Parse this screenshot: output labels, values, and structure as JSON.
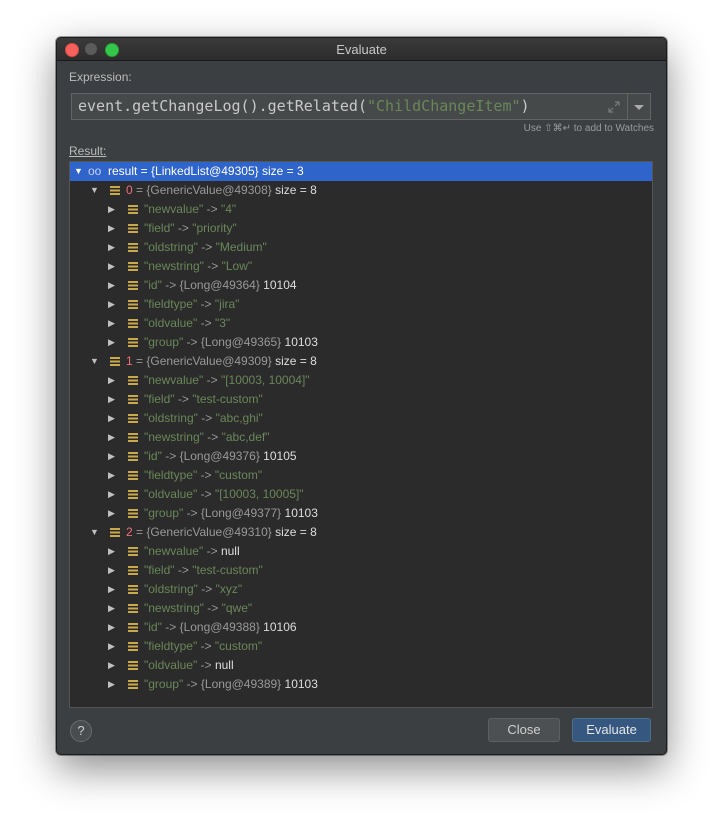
{
  "window": {
    "title": "Evaluate"
  },
  "expression": {
    "label": "Expression:",
    "code_prefix": "event.getChangeLog().getRelated(",
    "code_string": "\"ChildChangeItem\"",
    "code_suffix": ")",
    "hint": "Use ⇧⌘↵ to add to Watches"
  },
  "result": {
    "label": "Result:",
    "root": "result = {LinkedList@49305}  size = 3",
    "groups": [
      {
        "index": "0",
        "ref": "= {GenericValue@49308}",
        "size": "size = 8",
        "items": [
          {
            "key": "\"newvalue\"",
            "arrow": "->",
            "val": "\"4\""
          },
          {
            "key": "\"field\"",
            "arrow": "->",
            "val": "\"priority\""
          },
          {
            "key": "\"oldstring\"",
            "arrow": "->",
            "val": "\"Medium\""
          },
          {
            "key": "\"newstring\"",
            "arrow": "->",
            "val": "\"Low\""
          },
          {
            "key": "\"id\"",
            "arrow": "->",
            "ref": "{Long@49364}",
            "num": "10104"
          },
          {
            "key": "\"fieldtype\"",
            "arrow": "->",
            "val": "\"jira\""
          },
          {
            "key": "\"oldvalue\"",
            "arrow": "->",
            "val": "\"3\""
          },
          {
            "key": "\"group\"",
            "arrow": "->",
            "ref": "{Long@49365}",
            "num": "10103"
          }
        ]
      },
      {
        "index": "1",
        "ref": "= {GenericValue@49309}",
        "size": "size = 8",
        "items": [
          {
            "key": "\"newvalue\"",
            "arrow": "->",
            "val": "\"[10003, 10004]\""
          },
          {
            "key": "\"field\"",
            "arrow": "->",
            "val": "\"test-custom\""
          },
          {
            "key": "\"oldstring\"",
            "arrow": "->",
            "val": "\"abc,ghi\""
          },
          {
            "key": "\"newstring\"",
            "arrow": "->",
            "val": "\"abc,def\""
          },
          {
            "key": "\"id\"",
            "arrow": "->",
            "ref": "{Long@49376}",
            "num": "10105"
          },
          {
            "key": "\"fieldtype\"",
            "arrow": "->",
            "val": "\"custom\""
          },
          {
            "key": "\"oldvalue\"",
            "arrow": "->",
            "val": "\"[10003, 10005]\""
          },
          {
            "key": "\"group\"",
            "arrow": "->",
            "ref": "{Long@49377}",
            "num": "10103"
          }
        ]
      },
      {
        "index": "2",
        "ref": "= {GenericValue@49310}",
        "size": "size = 8",
        "items": [
          {
            "key": "\"newvalue\"",
            "arrow": "->",
            "num": "null"
          },
          {
            "key": "\"field\"",
            "arrow": "->",
            "val": "\"test-custom\""
          },
          {
            "key": "\"oldstring\"",
            "arrow": "->",
            "val": "\"xyz\""
          },
          {
            "key": "\"newstring\"",
            "arrow": "->",
            "val": "\"qwe\""
          },
          {
            "key": "\"id\"",
            "arrow": "->",
            "ref": "{Long@49388}",
            "num": "10106"
          },
          {
            "key": "\"fieldtype\"",
            "arrow": "->",
            "val": "\"custom\""
          },
          {
            "key": "\"oldvalue\"",
            "arrow": "->",
            "num": "null"
          },
          {
            "key": "\"group\"",
            "arrow": "->",
            "ref": "{Long@49389}",
            "num": "10103"
          }
        ]
      }
    ]
  },
  "buttons": {
    "help": "?",
    "close": "Close",
    "evaluate": "Evaluate"
  },
  "colors": {
    "selection": "#2f65ca",
    "string": "#6a8759",
    "index": "#f07178",
    "primary_button": "#365880"
  }
}
